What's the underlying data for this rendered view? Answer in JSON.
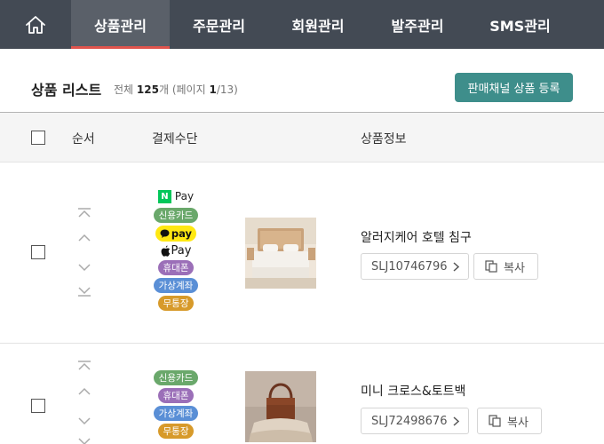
{
  "nav": {
    "home_icon": "home-icon",
    "tabs": [
      {
        "label": "상품관리",
        "active": true
      },
      {
        "label": "주문관리",
        "active": false
      },
      {
        "label": "회원관리",
        "active": false
      },
      {
        "label": "발주관리",
        "active": false
      },
      {
        "label": "SMS관리",
        "active": false
      }
    ],
    "colors": {
      "bar": "#434a54",
      "active": "#5a6069",
      "indicator": "#e0544d"
    }
  },
  "list": {
    "title": "상품 리스트",
    "summary": {
      "total_label": "전체",
      "total_count": "125",
      "total_unit": "개 (페이지",
      "page": "1",
      "page_total": "/13)"
    },
    "register_button": "판매채널 상품 등록",
    "accent_color": "#3e8e8b"
  },
  "table": {
    "headers": {
      "order": "순서",
      "payment": "결제수단",
      "product": "상품정보"
    },
    "rows": [
      {
        "name": "알러지케어 호텔 침구",
        "sku": "SLJ10746796",
        "copy_label": "복사",
        "payments": {
          "npay": {
            "mark": "N",
            "text": "Pay"
          },
          "card": "신용카드",
          "kakao": "pay",
          "apple": "Pay",
          "phone": "휴대폰",
          "virtual": "가상계좌",
          "bank": "무통장"
        }
      },
      {
        "name": "미니 크로스&토트백",
        "sku": "SLJ72498676",
        "copy_label": "복사",
        "payments": {
          "card": "신용카드",
          "phone": "휴대폰",
          "virtual": "가상계좌",
          "bank": "무통장"
        }
      }
    ]
  },
  "badge_colors": {
    "card": "#6aa86b",
    "phone": "#9b6fb8",
    "virtual": "#5a8fd6",
    "bank": "#d79a2a",
    "kakao": "#ffe812",
    "npay": "#03c75a"
  }
}
